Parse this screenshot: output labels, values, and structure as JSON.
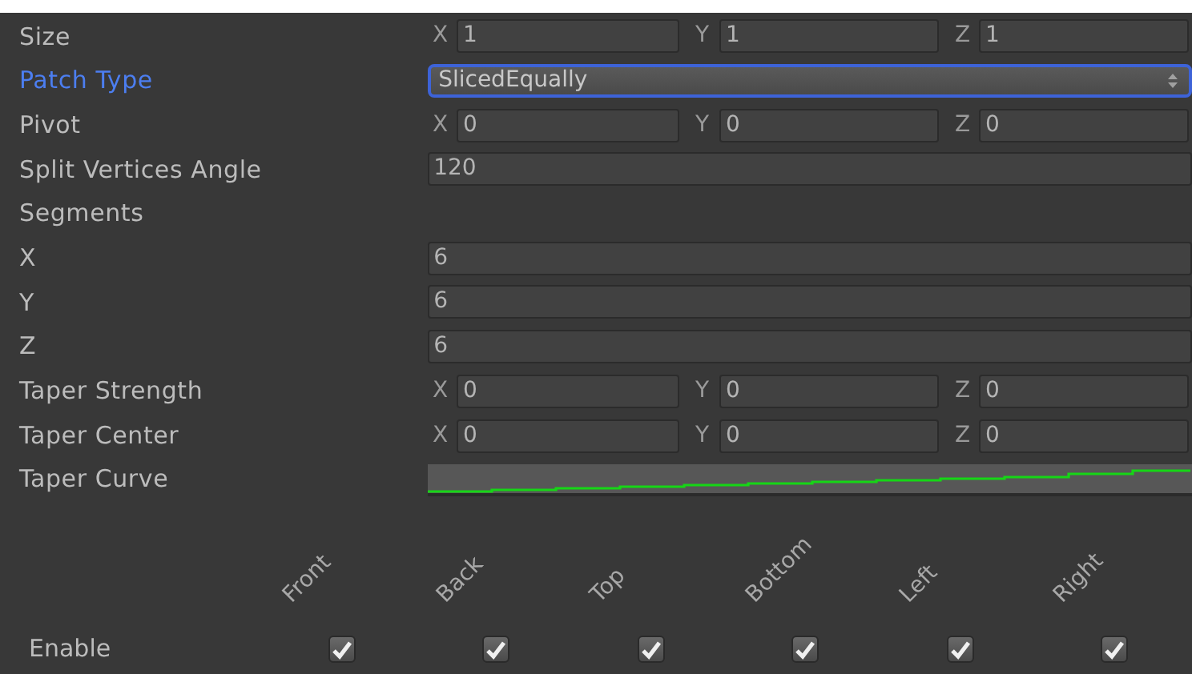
{
  "rows": [
    {
      "kind": "vector3",
      "label": "Size",
      "focused": false,
      "parts": [
        {
          "axis": "X",
          "value": "1"
        },
        {
          "axis": "Y",
          "value": "1"
        },
        {
          "axis": "Z",
          "value": "1"
        }
      ]
    },
    {
      "kind": "dropdown",
      "label": "Patch Type",
      "focused": true,
      "value": "SlicedEqually"
    },
    {
      "kind": "vector3",
      "label": "Pivot",
      "focused": false,
      "parts": [
        {
          "axis": "X",
          "value": "0"
        },
        {
          "axis": "Y",
          "value": "0"
        },
        {
          "axis": "Z",
          "value": "0"
        }
      ]
    },
    {
      "kind": "number",
      "label": "Split Vertices Angle",
      "focused": false,
      "value": "120"
    },
    {
      "kind": "header",
      "label": "Segments",
      "focused": false
    },
    {
      "kind": "number",
      "label": "X",
      "focused": false,
      "value": "6"
    },
    {
      "kind": "number",
      "label": "Y",
      "focused": false,
      "value": "6"
    },
    {
      "kind": "number",
      "label": "Z",
      "focused": false,
      "value": "6"
    },
    {
      "kind": "vector3",
      "label": "Taper Strength",
      "focused": false,
      "parts": [
        {
          "axis": "X",
          "value": "0"
        },
        {
          "axis": "Y",
          "value": "0"
        },
        {
          "axis": "Z",
          "value": "0"
        }
      ]
    },
    {
      "kind": "vector3",
      "label": "Taper Center",
      "focused": false,
      "parts": [
        {
          "axis": "X",
          "value": "0"
        },
        {
          "axis": "Y",
          "value": "0"
        },
        {
          "axis": "Z",
          "value": "0"
        }
      ]
    },
    {
      "kind": "curve",
      "label": "Taper Curve",
      "focused": false
    }
  ],
  "faces": {
    "label": "Enable",
    "items": [
      {
        "label": "Front",
        "checked": true
      },
      {
        "label": "Back",
        "checked": true
      },
      {
        "label": "Top",
        "checked": true
      },
      {
        "label": "Bottom",
        "checked": true
      },
      {
        "label": "Left",
        "checked": true
      },
      {
        "label": "Right",
        "checked": true
      }
    ]
  }
}
